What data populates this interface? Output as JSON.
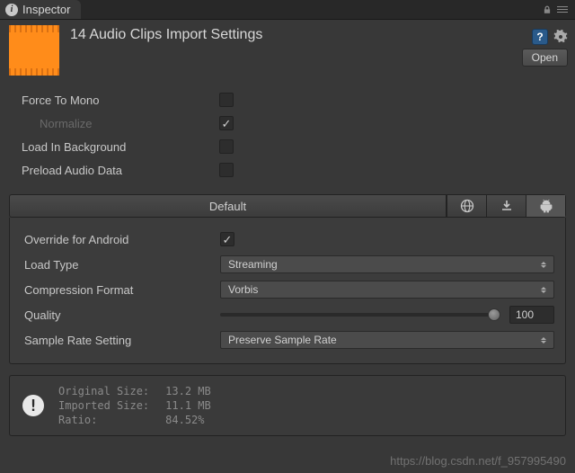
{
  "tab": {
    "label": "Inspector"
  },
  "header": {
    "title": "14 Audio Clips Import Settings",
    "open_button": "Open"
  },
  "settings": {
    "force_to_mono": {
      "label": "Force To Mono",
      "checked": false
    },
    "normalize": {
      "label": "Normalize",
      "checked": true
    },
    "load_in_background": {
      "label": "Load In Background",
      "checked": false
    },
    "preload_audio_data": {
      "label": "Preload Audio Data",
      "checked": false
    }
  },
  "platform": {
    "default_label": "Default",
    "override": {
      "label": "Override for Android",
      "checked": true
    },
    "load_type": {
      "label": "Load Type",
      "value": "Streaming"
    },
    "compression_format": {
      "label": "Compression Format",
      "value": "Vorbis"
    },
    "quality": {
      "label": "Quality",
      "value": "100"
    },
    "sample_rate": {
      "label": "Sample Rate Setting",
      "value": "Preserve Sample Rate"
    }
  },
  "info": {
    "original_label": "Original Size:",
    "original_value": "13.2 MB",
    "imported_label": "Imported Size:",
    "imported_value": "11.1 MB",
    "ratio_label": "Ratio:",
    "ratio_value": "84.52%"
  },
  "watermark": "https://blog.csdn.net/f_957995490"
}
